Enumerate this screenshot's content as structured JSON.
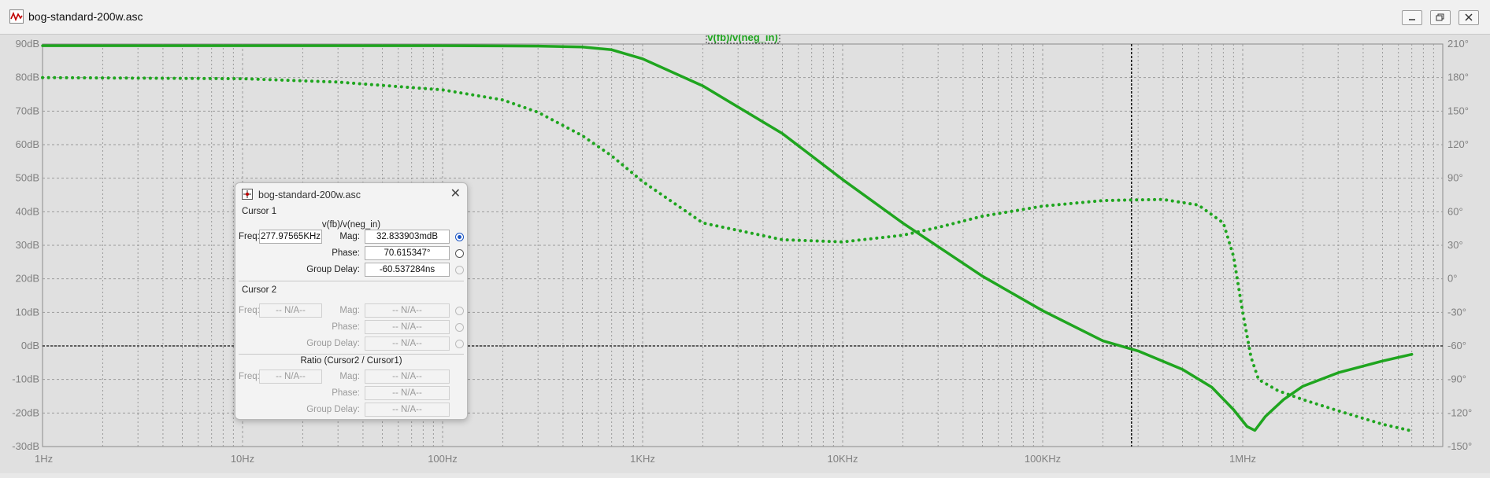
{
  "window": {
    "title": "bog-standard-200w.asc"
  },
  "icons": {
    "app": "waveform-icon",
    "dialog": "cursor-probe-icon"
  },
  "colors": {
    "trace": "#1fa51f",
    "grid": "#9a9a9a",
    "background": "#e0e0e0"
  },
  "chart_data": {
    "type": "line",
    "title": "v(fb)/v(neg_in)",
    "xscale": "log",
    "xlim": [
      1,
      10000000
    ],
    "x_ticks": [
      "1Hz",
      "10Hz",
      "100Hz",
      "1KHz",
      "10KHz",
      "100KHz",
      "1MHz"
    ],
    "ylim_left": [
      -30,
      90
    ],
    "y_ticks_left": [
      "90dB",
      "80dB",
      "70dB",
      "60dB",
      "50dB",
      "40dB",
      "30dB",
      "20dB",
      "10dB",
      "0dB",
      "-10dB",
      "-20dB",
      "-30dB"
    ],
    "ylim_right": [
      -150,
      210
    ],
    "y_ticks_right": [
      "210°",
      "180°",
      "150°",
      "120°",
      "90°",
      "60°",
      "30°",
      "0°",
      "-30°",
      "-60°",
      "-90°",
      "-120°",
      "-150°"
    ],
    "grid": true,
    "cursor_x": 277975.65,
    "series": [
      {
        "name": "magnitude",
        "unit": "dB",
        "style": "solid",
        "x": [
          1,
          10,
          100,
          300,
          500,
          700,
          1000,
          2000,
          5000,
          10000,
          20000,
          50000,
          100000,
          200000,
          300000,
          500000,
          700000,
          900000,
          1050000,
          1150000,
          1300000,
          1600000,
          2000000,
          3000000,
          5000000,
          7000000
        ],
        "y": [
          89.5,
          89.5,
          89.5,
          89.4,
          89.1,
          88.3,
          85.6,
          77.5,
          63.3,
          49.6,
          36.6,
          20.8,
          10.5,
          1.5,
          -1.5,
          -7.0,
          -12.3,
          -19.0,
          -24.0,
          -25.2,
          -21.0,
          -16.0,
          -12.0,
          -8.0,
          -4.5,
          -2.5
        ]
      },
      {
        "name": "phase",
        "unit": "°",
        "style": "dotted",
        "x": [
          1,
          10,
          30,
          100,
          200,
          300,
          500,
          700,
          1000,
          2000,
          5000,
          10000,
          20000,
          30000,
          50000,
          100000,
          200000,
          277975.65,
          400000,
          600000,
          800000,
          900000,
          1000000,
          1100000,
          1200000,
          1500000,
          2000000,
          3000000,
          5000000,
          7000000
        ],
        "y": [
          180,
          179,
          176,
          169,
          160,
          149,
          128,
          110,
          87,
          50,
          35,
          33,
          39,
          46,
          56,
          65,
          70,
          70.6,
          71,
          66,
          50,
          20,
          -30,
          -70,
          -90,
          -100,
          -108,
          -118,
          -130,
          -136
        ]
      }
    ]
  },
  "cursor_dialog": {
    "title": "bog-standard-200w.asc",
    "cursor1": {
      "heading": "Cursor 1",
      "trace": "v(fb)/v(neg_in)",
      "freq_label": "Freq:",
      "freq": "277.97565KHz",
      "mag_label": "Mag:",
      "mag": "32.833903mdB",
      "phase_label": "Phase:",
      "phase": "70.615347°",
      "gd_label": "Group Delay:",
      "gd": "-60.537284ns"
    },
    "cursor2": {
      "heading": "Cursor 2",
      "freq_label": "Freq:",
      "freq": "-- N/A--",
      "mag_label": "Mag:",
      "mag": "-- N/A--",
      "phase_label": "Phase:",
      "phase": "-- N/A--",
      "gd_label": "Group Delay:",
      "gd": "-- N/A--"
    },
    "ratio": {
      "heading": "Ratio (Cursor2 / Cursor1)",
      "freq_label": "Freq:",
      "freq": "-- N/A--",
      "mag_label": "Mag:",
      "mag": "-- N/A--",
      "phase_label": "Phase:",
      "phase": "-- N/A--",
      "gd_label": "Group Delay:",
      "gd": "-- N/A--"
    }
  }
}
